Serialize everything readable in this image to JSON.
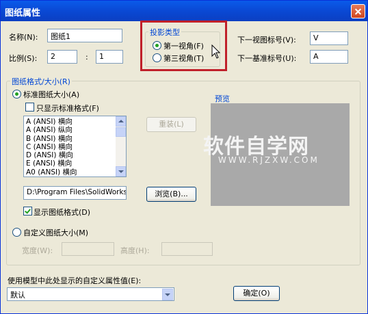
{
  "dialog": {
    "title": "图纸属性"
  },
  "fields": {
    "name_label": "名称(N):",
    "name_value": "图纸1",
    "scale_label": "比例(S):",
    "scale_num": "2",
    "scale_sep": ":",
    "scale_den": "1",
    "next_view_label": "下一视图标号(V):",
    "next_view_value": "V",
    "next_datum_label": "下一基准标号(U):",
    "next_datum_value": "A"
  },
  "projection": {
    "title": "投影类型",
    "first_angle": "第一视角(F)",
    "third_angle": "第三视角(T)",
    "selected": "first_angle"
  },
  "sheet_format": {
    "title": "图纸格式/大小(R)",
    "standard_label": "标准图纸大小(A)",
    "only_standard_label": "只显示标准格式(F)",
    "only_standard_checked": false,
    "sizes": [
      "A (ANSI) 横向",
      "A (ANSI) 纵向",
      "B (ANSI) 横向",
      "C (ANSI) 横向",
      "D (ANSI) 横向",
      "E (ANSI) 横向",
      "A0 (ANSI) 横向"
    ],
    "reload_label": "重装(L)",
    "path_value": "D:\\Program Files\\SolidWorks\\c",
    "browse_label": "浏览(B)...",
    "show_format_label": "显示图纸格式(D)",
    "show_format_checked": true,
    "custom_label": "自定义图纸大小(M)",
    "width_label": "宽度(W):",
    "height_label": "高度(H):",
    "preview_label": "预览"
  },
  "footer": {
    "custom_prop_label": "使用模型中此处显示的自定义属性值(E):",
    "custom_prop_value": "默认",
    "ok_label": "确定(O)"
  },
  "watermark": {
    "line1": "软件自学网",
    "line2": "WWW.RJZXW.COM"
  },
  "colors": {
    "titlebar": "#0A4AD6",
    "dialog_bg": "#ECE9D8",
    "highlight_box": "#C0202A",
    "label_blue": "#0046D5",
    "preview_bg": "#A9A9A9"
  }
}
